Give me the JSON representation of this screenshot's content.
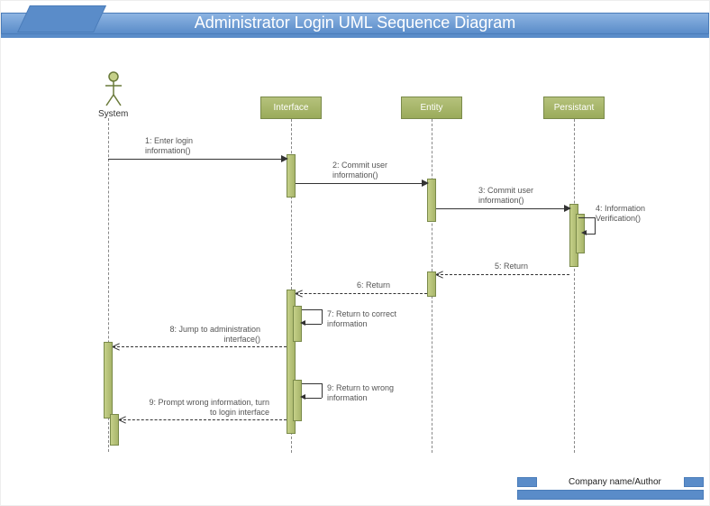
{
  "title": "Administrator Login UML Sequence Diagram",
  "actor": {
    "label": "System"
  },
  "lifelines": {
    "interface": "Interface",
    "entity": "Entity",
    "persistant": "Persistant"
  },
  "messages": {
    "m1": "1: Enter login information()",
    "m2": "2: Commit user information()",
    "m3": "3: Commit user information()",
    "m4": "4: Information Verification()",
    "m5": "5: Return",
    "m6": "6: Return",
    "m7": "7: Return to correct information",
    "m8": "8: Jump to administration interface()",
    "m9a": "9: Return to wrong information",
    "m9b": "9: Prompt wrong information, turn to login interface"
  },
  "footer": "Company name/Author",
  "colors": {
    "header": "#5a8cc9",
    "lifeline_box": "#a8b56a",
    "activation": "#b5c27c"
  },
  "chart_data": {
    "type": "uml-sequence",
    "title": "Administrator Login UML Sequence Diagram",
    "participants": [
      {
        "id": "system",
        "name": "System",
        "kind": "actor"
      },
      {
        "id": "interface",
        "name": "Interface",
        "kind": "object"
      },
      {
        "id": "entity",
        "name": "Entity",
        "kind": "object"
      },
      {
        "id": "persistant",
        "name": "Persistant",
        "kind": "object"
      }
    ],
    "messages": [
      {
        "seq": 1,
        "from": "system",
        "to": "interface",
        "label": "Enter login information()",
        "style": "sync"
      },
      {
        "seq": 2,
        "from": "interface",
        "to": "entity",
        "label": "Commit user information()",
        "style": "sync"
      },
      {
        "seq": 3,
        "from": "entity",
        "to": "persistant",
        "label": "Commit user information()",
        "style": "sync"
      },
      {
        "seq": 4,
        "from": "persistant",
        "to": "persistant",
        "label": "Information Verification()",
        "style": "self"
      },
      {
        "seq": 5,
        "from": "persistant",
        "to": "entity",
        "label": "Return",
        "style": "return"
      },
      {
        "seq": 6,
        "from": "entity",
        "to": "interface",
        "label": "Return",
        "style": "return"
      },
      {
        "seq": 7,
        "from": "interface",
        "to": "interface",
        "label": "Return to correct information",
        "style": "self"
      },
      {
        "seq": 8,
        "from": "interface",
        "to": "system",
        "label": "Jump to administration interface()",
        "style": "return"
      },
      {
        "seq": 9,
        "from": "interface",
        "to": "interface",
        "label": "Return to wrong information",
        "style": "self"
      },
      {
        "seq": 9,
        "from": "interface",
        "to": "system",
        "label": "Prompt wrong information, turn to login interface",
        "style": "return"
      }
    ]
  }
}
